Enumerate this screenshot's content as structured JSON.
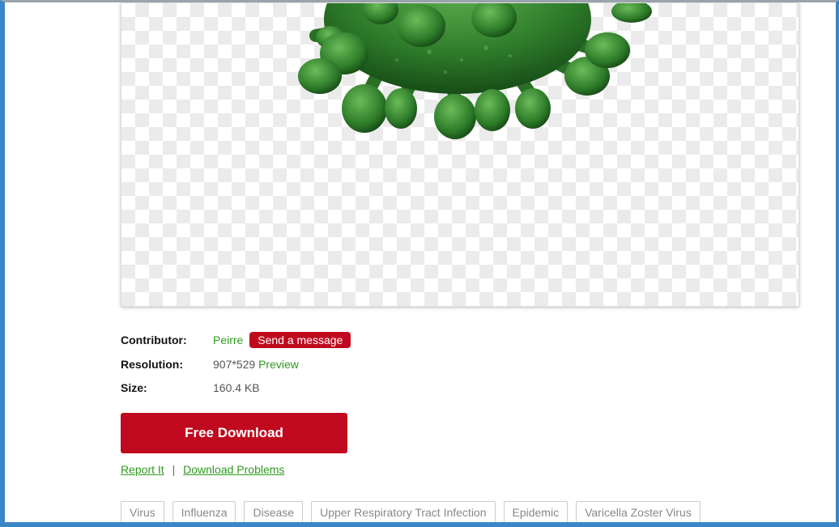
{
  "details": {
    "contributor_label": "Contributor:",
    "contributor_name": "Peirre",
    "send_message_label": "Send a message",
    "resolution_label": "Resolution:",
    "resolution_value": "907*529",
    "preview_label": "Preview",
    "size_label": "Size:",
    "size_value": "160.4 KB"
  },
  "actions": {
    "free_download_label": "Free Download",
    "report_label": "Report It",
    "separator": "|",
    "download_problems_label": "Download Problems"
  },
  "tags": [
    "Virus",
    "Influenza",
    "Disease",
    "Upper Respiratory Tract Infection",
    "Epidemic",
    "Varicella Zoster Virus"
  ],
  "colors": {
    "accent_red": "#c0091e",
    "link_green": "#2e9a1e",
    "window_border": "#3a86c6",
    "virus_green": "#2f7d2b"
  },
  "icons": {
    "preview_image": "green-virus-image"
  }
}
